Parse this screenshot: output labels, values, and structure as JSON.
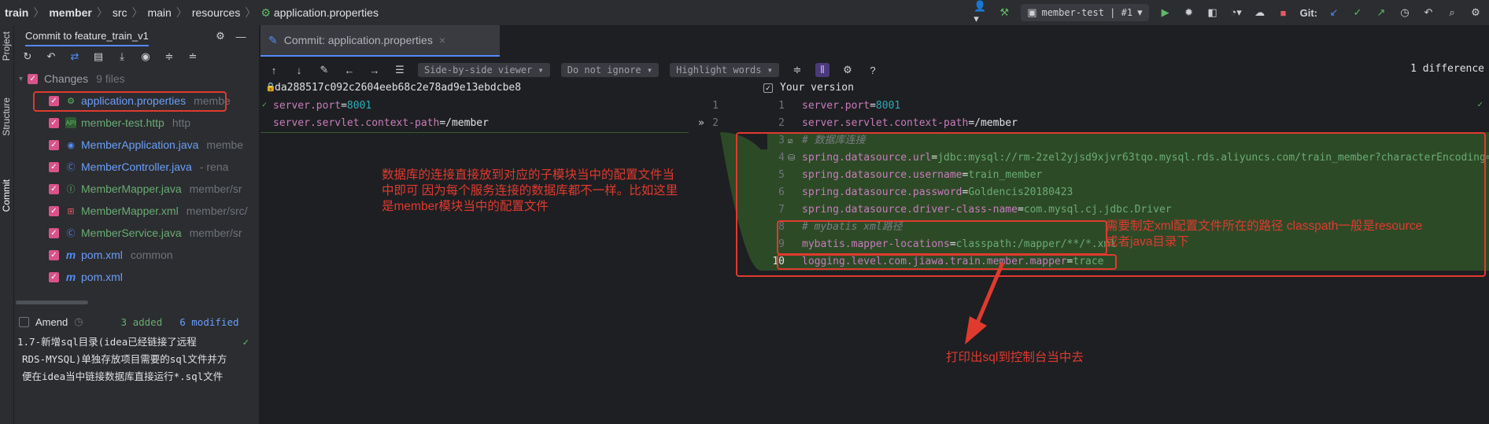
{
  "breadcrumbs": [
    "train",
    "member",
    "src",
    "main",
    "resources",
    "application.properties"
  ],
  "toolbar": {
    "run_config": "member-test | #1",
    "git_label": "Git:"
  },
  "stripe": {
    "project": "Project",
    "structure": "Structure",
    "commit": "Commit"
  },
  "commit_panel": {
    "title": "Commit to feature_train_v1",
    "changes_label": "Changes",
    "changes_count": "9 files",
    "files": [
      {
        "name": "application.properties",
        "path": "membe"
      },
      {
        "name": "member-test.http",
        "path": "http"
      },
      {
        "name": "MemberApplication.java",
        "path": "membe"
      },
      {
        "name": "MemberController.java",
        "path": "- rena"
      },
      {
        "name": "MemberMapper.java",
        "path": "member/sr"
      },
      {
        "name": "MemberMapper.xml",
        "path": "member/src/"
      },
      {
        "name": "MemberService.java",
        "path": "member/sr"
      },
      {
        "name": "pom.xml",
        "path": "common"
      },
      {
        "name": "pom.xml",
        "path": ""
      }
    ],
    "amend_label": "Amend",
    "added": "3 added",
    "modified": "6 modified",
    "message_lines": [
      "1.7-新增sql目录(idea已经链接了远程",
      "RDS-MYSQL)单独存放项目需要的sql文件并方",
      "便在idea当中链接数据库直接运行*.sql文件"
    ]
  },
  "diff": {
    "tab_title": "Commit: application.properties",
    "viewer": "Side-by-side viewer",
    "ignore": "Do not ignore",
    "highlight": "Highlight words",
    "difference_count": "1 difference",
    "left_hash": "da288517c092c2604eeb68c2e78ad9e13ebdcbe8",
    "right_label": "Your version",
    "left_lines": [
      {
        "key": "server.port",
        "value": "8001"
      },
      {
        "key": "server.servlet.context-path",
        "value": "/member"
      }
    ],
    "right_lines": [
      {
        "num": "1",
        "key": "server.port",
        "value": "8001"
      },
      {
        "num": "2",
        "key": "server.servlet.context-path",
        "value": "/member"
      },
      {
        "num": "3",
        "comment": "# 数据库连接"
      },
      {
        "num": "4",
        "key": "spring.datasource.url",
        "value": "jdbc:mysql://rm-2zel2yjsd9xjvr63tqo.mysql.rds.aliyuncs.com/train_member?characterEncoding=U"
      },
      {
        "num": "5",
        "key": "spring.datasource.username",
        "value": "train_member"
      },
      {
        "num": "6",
        "key": "spring.datasource.password",
        "value": "Goldencis20180423"
      },
      {
        "num": "7",
        "key": "spring.datasource.driver-class-name",
        "value": "com.mysql.cj.jdbc.Driver"
      },
      {
        "num": "8",
        "comment": "# mybatis xml路径"
      },
      {
        "num": "9",
        "key": "mybatis.mapper-locations",
        "value": "classpath:/mapper/**/*.xml"
      },
      {
        "num": "10",
        "key": "logging.level.com.jiawa.train.member.mapper",
        "value": "trace"
      }
    ]
  },
  "annotations": {
    "note1": "数据库的连接直接放到对应的子模块当中的配置文件当中即可 因为每个服务连接的数据库都不一样。比如这里是member模块当中的配置文件",
    "note2_line1": "需要制定xml配置文件所在的路径 classpath一般是resource",
    "note2_line2": "或者java目录下",
    "note3": "打印出sql到控制台当中去"
  },
  "colors": {
    "accent": "#548af7",
    "annotation": "#e03a2f",
    "added_bg": "#2d4a27",
    "checkbox": "#d9538a"
  }
}
